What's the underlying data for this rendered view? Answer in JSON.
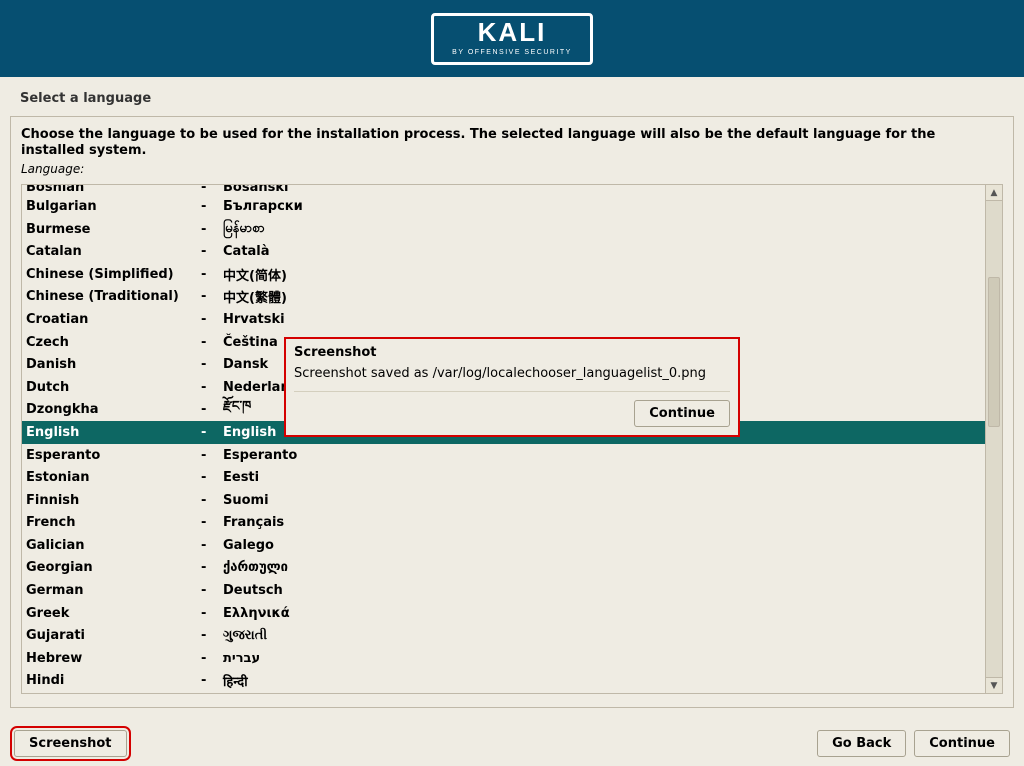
{
  "header": {
    "logo_text": "KALI",
    "logo_sub": "BY OFFENSIVE SECURITY"
  },
  "title": "Select a language",
  "instruction": "Choose the language to be used for the installation process. The selected language will also be the default language for the installed system.",
  "field_label": "Language:",
  "languages": [
    {
      "name": "Bosnian",
      "native": "Bosanski",
      "clipped": true
    },
    {
      "name": "Bulgarian",
      "native": "Български"
    },
    {
      "name": "Burmese",
      "native": "မြန်မာစာ"
    },
    {
      "name": "Catalan",
      "native": "Català"
    },
    {
      "name": "Chinese (Simplified)",
      "native": "中文(简体)"
    },
    {
      "name": "Chinese (Traditional)",
      "native": "中文(繁體)"
    },
    {
      "name": "Croatian",
      "native": "Hrvatski"
    },
    {
      "name": "Czech",
      "native": "Čeština"
    },
    {
      "name": "Danish",
      "native": "Dansk"
    },
    {
      "name": "Dutch",
      "native": "Nederlan"
    },
    {
      "name": "Dzongkha",
      "native": "རྫོང་ཁ"
    },
    {
      "name": "English",
      "native": "English",
      "selected": true
    },
    {
      "name": "Esperanto",
      "native": "Esperanto"
    },
    {
      "name": "Estonian",
      "native": "Eesti"
    },
    {
      "name": "Finnish",
      "native": "Suomi"
    },
    {
      "name": "French",
      "native": "Français"
    },
    {
      "name": "Galician",
      "native": "Galego"
    },
    {
      "name": "Georgian",
      "native": "ქართული"
    },
    {
      "name": "German",
      "native": "Deutsch"
    },
    {
      "name": "Greek",
      "native": "Ελληνικά"
    },
    {
      "name": "Gujarati",
      "native": "ગુજરાતી"
    },
    {
      "name": "Hebrew",
      "native": "עברית"
    },
    {
      "name": "Hindi",
      "native": "हिन्दी"
    }
  ],
  "dialog": {
    "title": "Screenshot",
    "message": "Screenshot saved as /var/log/localechooser_languagelist_0.png",
    "continue": "Continue"
  },
  "footer": {
    "screenshot": "Screenshot",
    "go_back": "Go Back",
    "continue": "Continue"
  }
}
